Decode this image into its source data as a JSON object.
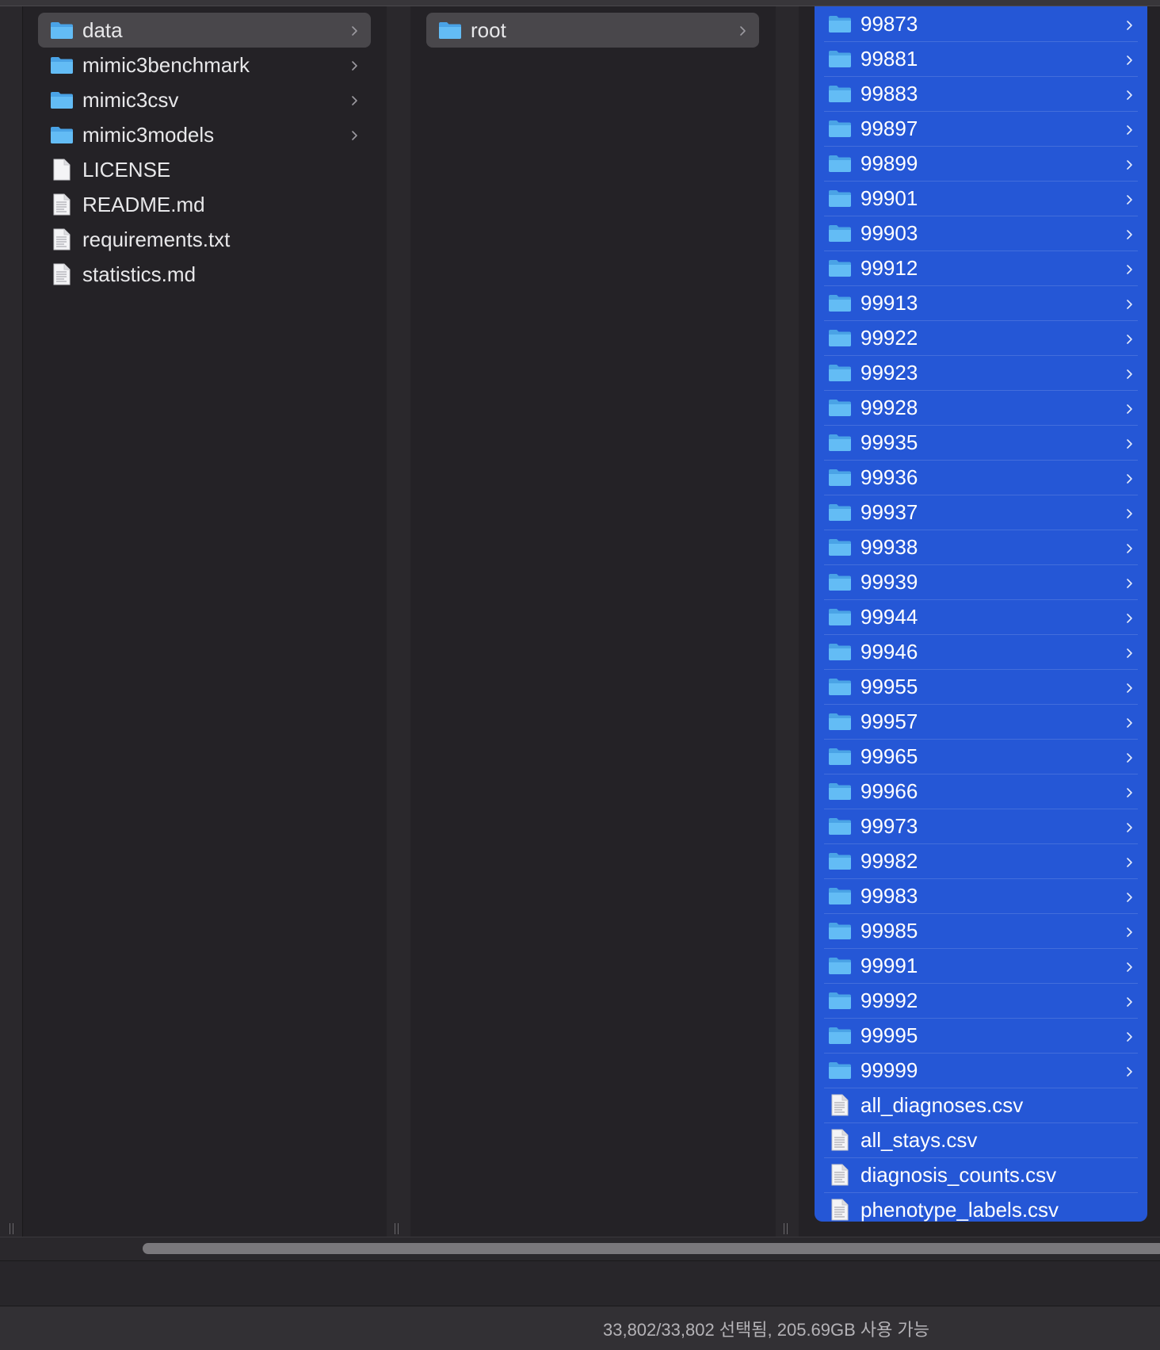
{
  "column1": {
    "items": [
      {
        "label": "data",
        "kind": "folder",
        "has_children": true,
        "selected": true
      },
      {
        "label": "mimic3benchmark",
        "kind": "folder",
        "has_children": true
      },
      {
        "label": "mimic3csv",
        "kind": "folder",
        "has_children": true
      },
      {
        "label": "mimic3models",
        "kind": "folder",
        "has_children": true
      },
      {
        "label": "LICENSE",
        "kind": "file-blank"
      },
      {
        "label": "README.md",
        "kind": "file-text"
      },
      {
        "label": "requirements.txt",
        "kind": "file-text"
      },
      {
        "label": "statistics.md",
        "kind": "file-text"
      }
    ]
  },
  "column2": {
    "items": [
      {
        "label": "root",
        "kind": "folder",
        "has_children": true,
        "selected": true
      }
    ]
  },
  "column3": {
    "items": [
      {
        "label": "99873",
        "kind": "folder"
      },
      {
        "label": "99881",
        "kind": "folder"
      },
      {
        "label": "99883",
        "kind": "folder"
      },
      {
        "label": "99897",
        "kind": "folder"
      },
      {
        "label": "99899",
        "kind": "folder"
      },
      {
        "label": "99901",
        "kind": "folder"
      },
      {
        "label": "99903",
        "kind": "folder"
      },
      {
        "label": "99912",
        "kind": "folder"
      },
      {
        "label": "99913",
        "kind": "folder"
      },
      {
        "label": "99922",
        "kind": "folder"
      },
      {
        "label": "99923",
        "kind": "folder"
      },
      {
        "label": "99928",
        "kind": "folder"
      },
      {
        "label": "99935",
        "kind": "folder"
      },
      {
        "label": "99936",
        "kind": "folder"
      },
      {
        "label": "99937",
        "kind": "folder"
      },
      {
        "label": "99938",
        "kind": "folder"
      },
      {
        "label": "99939",
        "kind": "folder"
      },
      {
        "label": "99944",
        "kind": "folder"
      },
      {
        "label": "99946",
        "kind": "folder"
      },
      {
        "label": "99955",
        "kind": "folder"
      },
      {
        "label": "99957",
        "kind": "folder"
      },
      {
        "label": "99965",
        "kind": "folder"
      },
      {
        "label": "99966",
        "kind": "folder"
      },
      {
        "label": "99973",
        "kind": "folder"
      },
      {
        "label": "99982",
        "kind": "folder"
      },
      {
        "label": "99983",
        "kind": "folder"
      },
      {
        "label": "99985",
        "kind": "folder"
      },
      {
        "label": "99991",
        "kind": "folder"
      },
      {
        "label": "99992",
        "kind": "folder"
      },
      {
        "label": "99995",
        "kind": "folder"
      },
      {
        "label": "99999",
        "kind": "folder"
      },
      {
        "label": "all_diagnoses.csv",
        "kind": "file-text"
      },
      {
        "label": "all_stays.csv",
        "kind": "file-text"
      },
      {
        "label": "diagnosis_counts.csv",
        "kind": "file-text"
      },
      {
        "label": "phenotype_labels.csv",
        "kind": "file-text"
      }
    ]
  },
  "status": {
    "text": "33,802/33,802 선택됨, 205.69GB 사용 가능"
  },
  "colors": {
    "selection_blue": "#2557d6",
    "selection_gray": "#49474b",
    "folder_blue": "#5ab4f0",
    "background": "#242226"
  }
}
